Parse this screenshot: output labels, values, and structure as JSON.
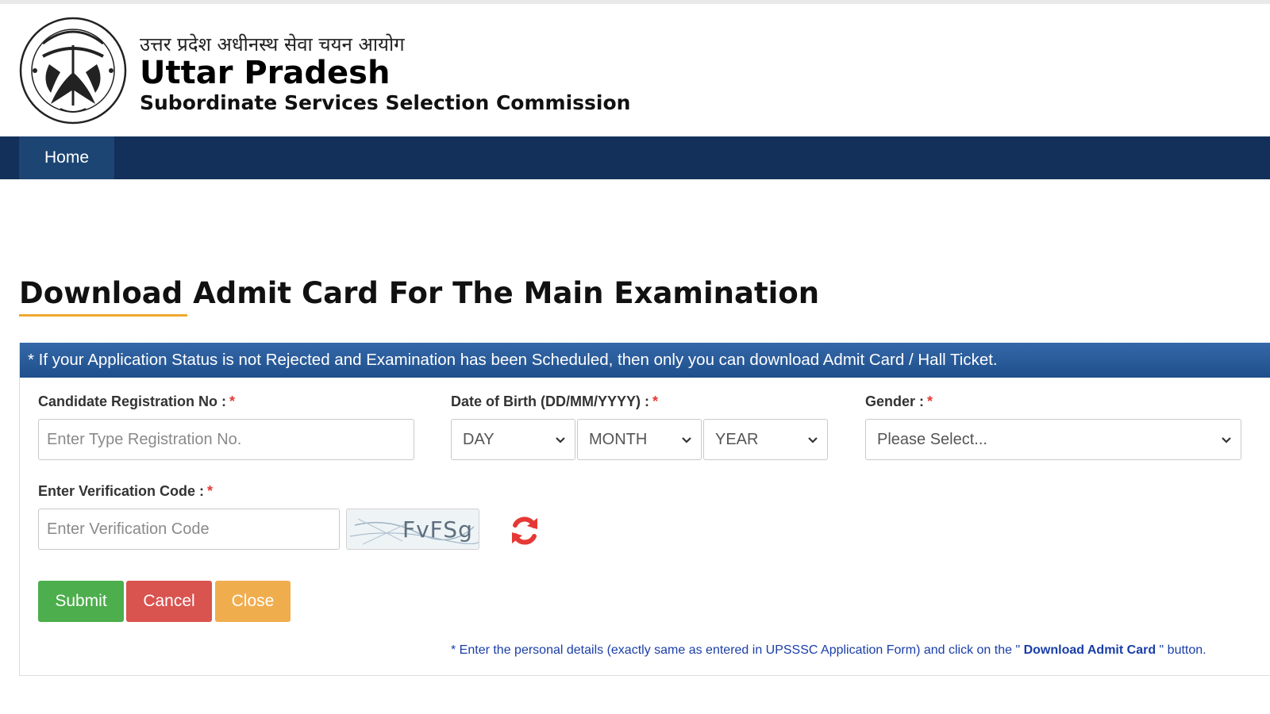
{
  "header": {
    "hindi_title": "उत्तर प्रदेश अधीनस्थ सेवा चयन आयोग",
    "title": "Uttar Pradesh",
    "subtitle": "Subordinate Services Selection Commission"
  },
  "nav": {
    "home_label": "Home"
  },
  "page": {
    "heading": "Download Admit Card For The Main Examination",
    "notice": "* If your Application Status is not Rejected and Examination has been Scheduled, then only you can download Admit Card / Hall Ticket."
  },
  "form": {
    "registration": {
      "label": "Candidate Registration No :",
      "placeholder": "Enter Type Registration No."
    },
    "dob": {
      "label": "Date of Birth (DD/MM/YYYY) :",
      "day": "DAY",
      "month": "MONTH",
      "year": "YEAR"
    },
    "gender": {
      "label": "Gender :",
      "selected": "Please Select..."
    },
    "verification": {
      "label": "Enter Verification Code :",
      "placeholder": "Enter Verification Code",
      "captcha": "FvFSg"
    },
    "required_mark": "*",
    "buttons": {
      "submit": "Submit",
      "cancel": "Cancel",
      "close": "Close"
    },
    "footnote": {
      "before": "* Enter the personal details (exactly same as entered in UPSSSC Application Form) and click on the \"",
      "highlight": " Download Admit Card ",
      "after": "\" button."
    }
  },
  "colors": {
    "navbar": "#13305a",
    "nav_active": "#1d4573",
    "notice_bar": "#2a5c9a",
    "submit": "#4cae4c",
    "cancel": "#d9534f",
    "close": "#f0ad4e",
    "accent_underline": "#f0a830",
    "refresh_icon": "#e53935"
  }
}
